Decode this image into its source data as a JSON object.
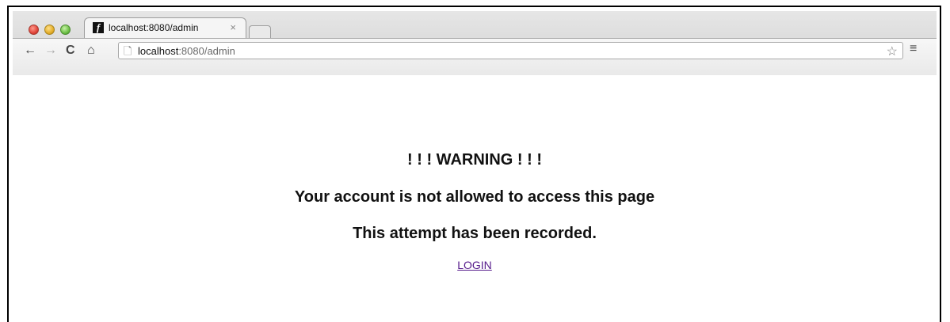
{
  "browser": {
    "tab_title": "localhost:8080/admin",
    "tab_favicon_letter": "f",
    "url_host": "localhost",
    "url_rest": ":8080/admin",
    "icons": [
      "back-arrow-icon",
      "forward-arrow-icon",
      "reload-icon",
      "home-icon",
      "page-icon",
      "star-icon",
      "menu-icon",
      "close-icon"
    ]
  },
  "page": {
    "warning": "! ! ! WARNING ! ! !",
    "message": "Your account is not allowed to access this page",
    "notice": "This attempt has been recorded.",
    "login_link": "LOGIN"
  }
}
